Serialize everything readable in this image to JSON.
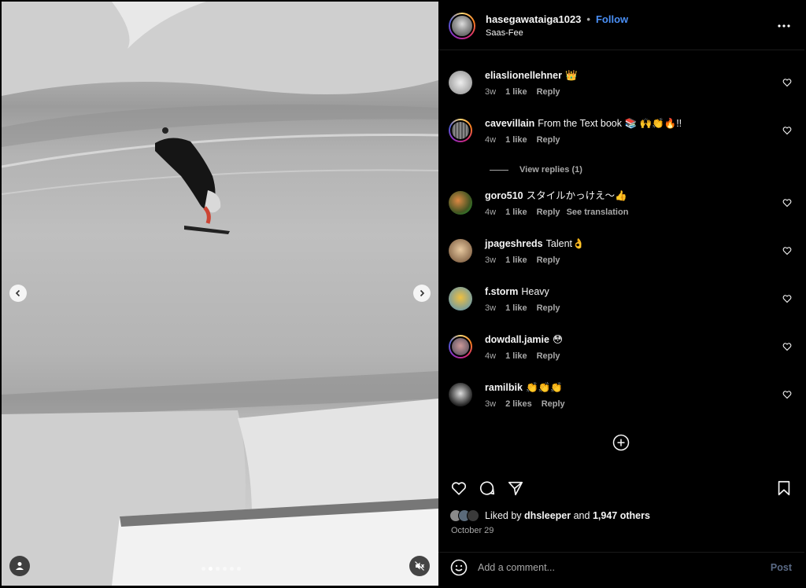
{
  "post": {
    "username": "hasegawataiga1023",
    "separator": "•",
    "follow_label": "Follow",
    "location": "Saas-Fee"
  },
  "comments": [
    {
      "user": "eliaslionellehner",
      "text": "👑",
      "age": "3w",
      "likes": "1 like",
      "reply": "Reply",
      "extra": ""
    },
    {
      "user": "cavevillain",
      "text": "From the Text book 📚 🙌👏🔥!!",
      "age": "4w",
      "likes": "1 like",
      "reply": "Reply",
      "extra": ""
    },
    {
      "user": "goro510",
      "text": "スタイルかっけえ〜👍",
      "age": "4w",
      "likes": "1 like",
      "reply": "Reply",
      "extra": "See translation"
    },
    {
      "user": "jpageshreds",
      "text": "Talent👌",
      "age": "3w",
      "likes": "1 like",
      "reply": "Reply",
      "extra": ""
    },
    {
      "user": "f.storm",
      "text": "Heavy",
      "age": "3w",
      "likes": "1 like",
      "reply": "Reply",
      "extra": ""
    },
    {
      "user": "dowdall.jamie",
      "text": "😳",
      "age": "4w",
      "likes": "1 like",
      "reply": "Reply",
      "extra": ""
    },
    {
      "user": "ramilbik",
      "text": "👏👏👏",
      "age": "3w",
      "likes": "2 likes",
      "reply": "Reply",
      "extra": ""
    }
  ],
  "view_replies_label": "View replies (1)",
  "likes": {
    "prefix": "Liked by",
    "user": "dhsleeper",
    "conj": "and",
    "others": "1,947 others"
  },
  "date": "October 29",
  "add_comment": {
    "placeholder": "Add a comment...",
    "post_label": "Post"
  },
  "carousel": {
    "count": 6,
    "active_index": 1
  },
  "colors": {
    "accent": "#4a8ff5",
    "background": "#000000",
    "muted": "#a8a8a8"
  },
  "icons": [
    "chevron-left-icon",
    "chevron-right-icon",
    "user-tag-icon",
    "mute-icon",
    "more-icon",
    "heart-icon",
    "comment-icon",
    "share-icon",
    "bookmark-icon",
    "add-circle-icon",
    "emoji-icon"
  ]
}
